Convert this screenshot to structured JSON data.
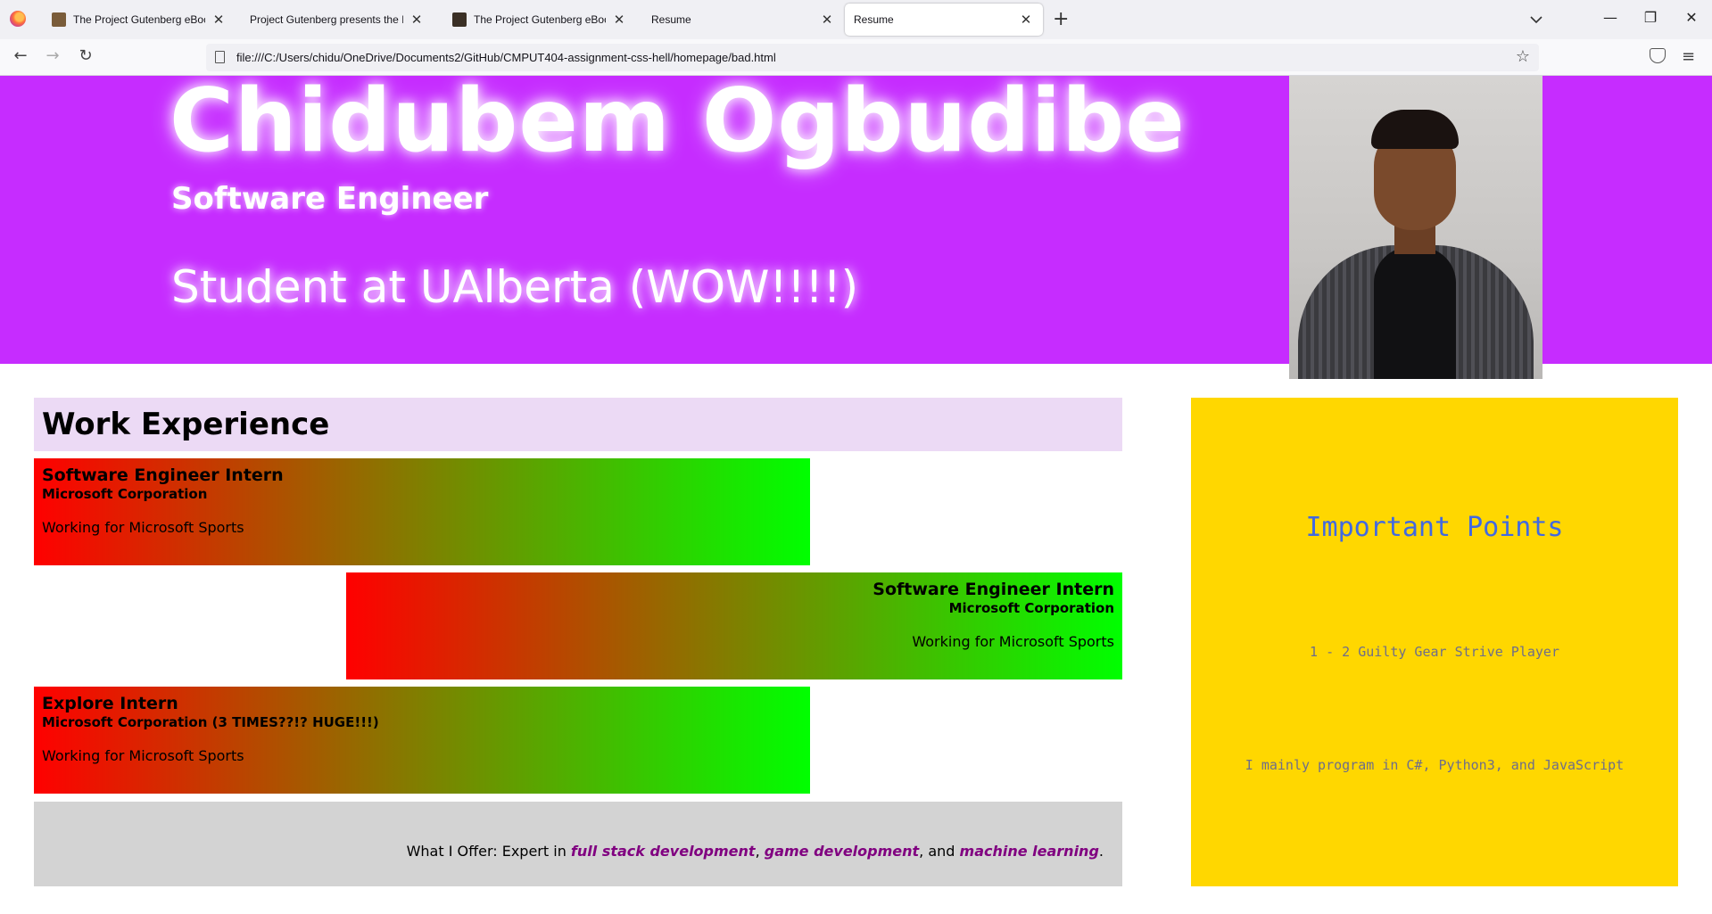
{
  "browser": {
    "tabs": [
      {
        "title": "The Project Gutenberg eBook of",
        "has_favicon": true
      },
      {
        "title": "Project Gutenberg presents the Illust",
        "has_favicon": false
      },
      {
        "title": "The Project Gutenberg eBook of",
        "has_favicon": true
      },
      {
        "title": "Resume",
        "has_favicon": false
      },
      {
        "title": "Resume",
        "has_favicon": false,
        "active": true
      }
    ],
    "new_tab_glyph": "+",
    "url": "file:///C:/Users/chidu/OneDrive/Documents2/GitHub/CMPUT404-assignment-css-hell/homepage/bad.html"
  },
  "hero": {
    "name": "Chidubem Ogbudibe",
    "role": "Software Engineer",
    "school": "Student at UAlberta (WOW!!!!)",
    "background_color": "#c62cff"
  },
  "work": {
    "heading": "Work Experience",
    "jobs": [
      {
        "title": "Software Engineer Intern",
        "company": "Microsoft Corporation",
        "desc": "Working for Microsoft Sports",
        "align": "left"
      },
      {
        "title": "Software Engineer Intern",
        "company": "Microsoft Corporation",
        "desc": "Working for Microsoft Sports",
        "align": "right"
      },
      {
        "title": "Explore Intern",
        "company": "Microsoft Corporation (3 TIMES??!? HUGE!!!)",
        "desc": "Working for Microsoft Sports",
        "align": "left"
      }
    ],
    "gradient": {
      "from": "#ff0000",
      "to": "#00ff00"
    }
  },
  "offer": {
    "prefix": "What I Offer: Expert in ",
    "skill1": "full stack development",
    "sep1": ", ",
    "skill2": "game development",
    "sep2": ", and ",
    "skill3": "machine learning",
    "suffix": "."
  },
  "points": {
    "heading": "Important Points",
    "items": [
      "1 - 2 Guilty Gear Strive Player",
      "I mainly program in C#, Python3, and JavaScript"
    ],
    "background_color": "#ffd700",
    "heading_color": "#4169e1"
  }
}
